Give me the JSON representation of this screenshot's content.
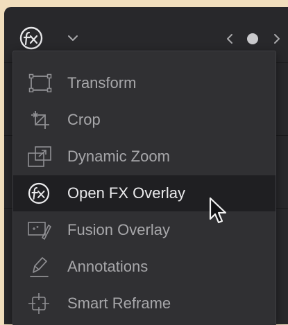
{
  "toolbar": {
    "effects_icon": "fx-icon",
    "dropdown_icon": "chevron-down-icon",
    "prev_icon": "chevron-left-icon",
    "indicator_icon": "dot-indicator",
    "next_icon": "chevron-right-icon"
  },
  "menu": {
    "items": [
      {
        "label": "Transform",
        "icon": "transform-icon"
      },
      {
        "label": "Crop",
        "icon": "crop-icon"
      },
      {
        "label": "Dynamic Zoom",
        "icon": "dynamic-zoom-icon"
      },
      {
        "label": "Open FX Overlay",
        "icon": "fx-icon",
        "highlighted": true
      },
      {
        "label": "Fusion Overlay",
        "icon": "fusion-overlay-icon"
      },
      {
        "label": "Annotations",
        "icon": "annotation-pen-icon"
      },
      {
        "label": "Smart Reframe",
        "icon": "smart-reframe-icon"
      }
    ]
  },
  "colors": {
    "page_background": "#f1debd",
    "panel_background": "#28282b",
    "menu_background": "#303033",
    "highlight_background": "#1f1f22",
    "item_text": "#a7a7aa",
    "highlight_text": "#eaeaec"
  }
}
